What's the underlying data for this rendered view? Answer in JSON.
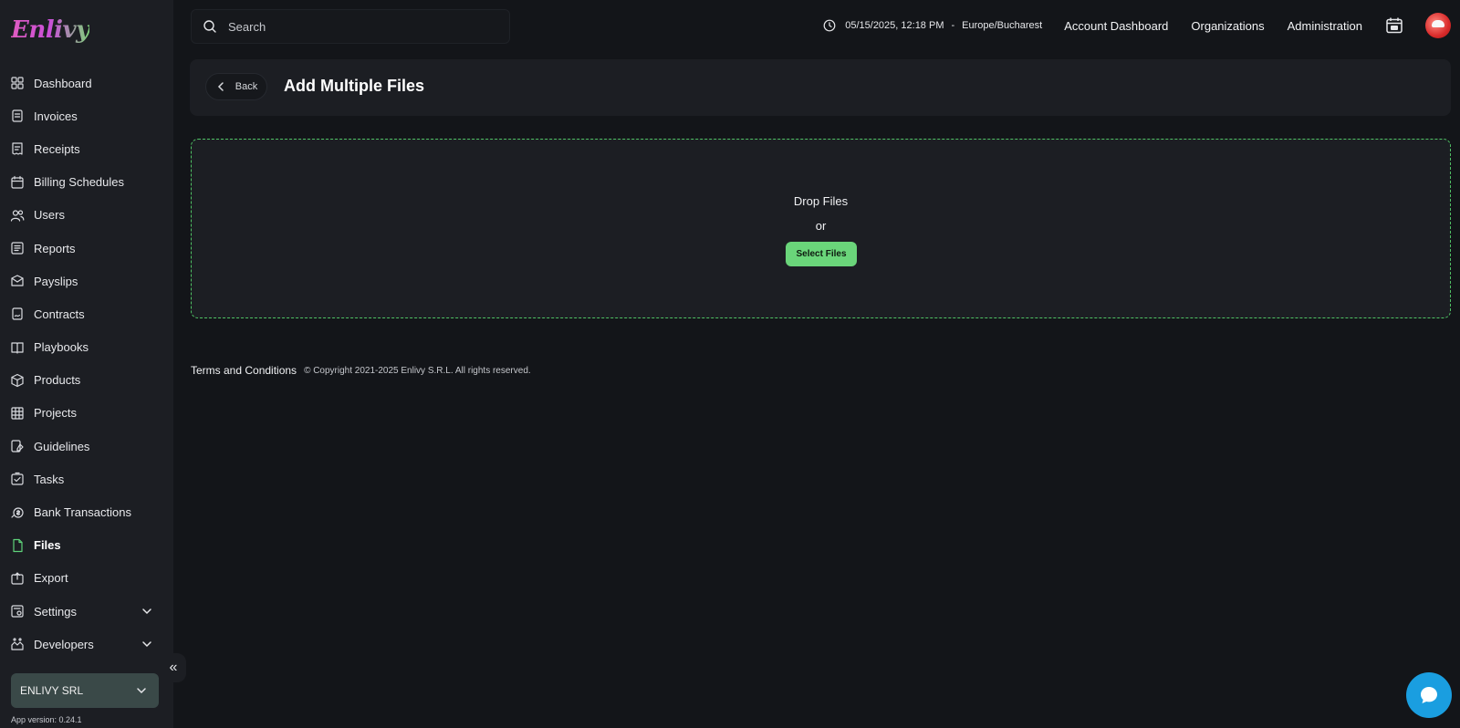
{
  "brand": {
    "logo_text": "Enlivy"
  },
  "search": {
    "placeholder": "Search"
  },
  "header": {
    "datetime": "05/15/2025, 12:18 PM",
    "separator": "-",
    "timezone": "Europe/Bucharest",
    "links": [
      "Account Dashboard",
      "Organizations",
      "Administration"
    ],
    "calendar_icon": "calendar-icon",
    "avatar_icon": "user-avatar"
  },
  "sidebar": {
    "items": [
      {
        "label": "Dashboard",
        "icon": "dashboard-icon"
      },
      {
        "label": "Invoices",
        "icon": "invoice-icon"
      },
      {
        "label": "Receipts",
        "icon": "receipt-icon"
      },
      {
        "label": "Billing Schedules",
        "icon": "billing-schedule-icon"
      },
      {
        "label": "Users",
        "icon": "users-icon"
      },
      {
        "label": "Reports",
        "icon": "reports-icon"
      },
      {
        "label": "Payslips",
        "icon": "payslip-icon"
      },
      {
        "label": "Contracts",
        "icon": "contract-icon"
      },
      {
        "label": "Playbooks",
        "icon": "playbook-icon"
      },
      {
        "label": "Products",
        "icon": "product-box-icon"
      },
      {
        "label": "Projects",
        "icon": "projects-icon"
      },
      {
        "label": "Guidelines",
        "icon": "guidelines-icon"
      },
      {
        "label": "Tasks",
        "icon": "tasks-icon"
      },
      {
        "label": "Bank Transactions",
        "icon": "bank-transactions-icon"
      },
      {
        "label": "Files",
        "icon": "file-icon",
        "active": true
      },
      {
        "label": "Export",
        "icon": "export-icon"
      },
      {
        "label": "Settings",
        "icon": "settings-icon",
        "expandable": true
      },
      {
        "label": "Developers",
        "icon": "developers-icon",
        "expandable": true
      }
    ],
    "org_name": "ENLIVY SRL",
    "app_version": "App version: 0.24.1"
  },
  "page": {
    "back_label": "Back",
    "title": "Add Multiple Files",
    "drop_title": "Drop Files",
    "drop_or": "or",
    "select_label": "Select Files"
  },
  "footer": {
    "terms": "Terms and Conditions",
    "copyright": "© Copyright 2021-2025 Enlivy S.R.L. All rights reserved."
  },
  "colors": {
    "accent_green": "#6ad57a",
    "dropzone_border": "#4fc264",
    "chat_blue": "#1a9ee0",
    "background": "#131519",
    "panel": "#1c1e23"
  }
}
